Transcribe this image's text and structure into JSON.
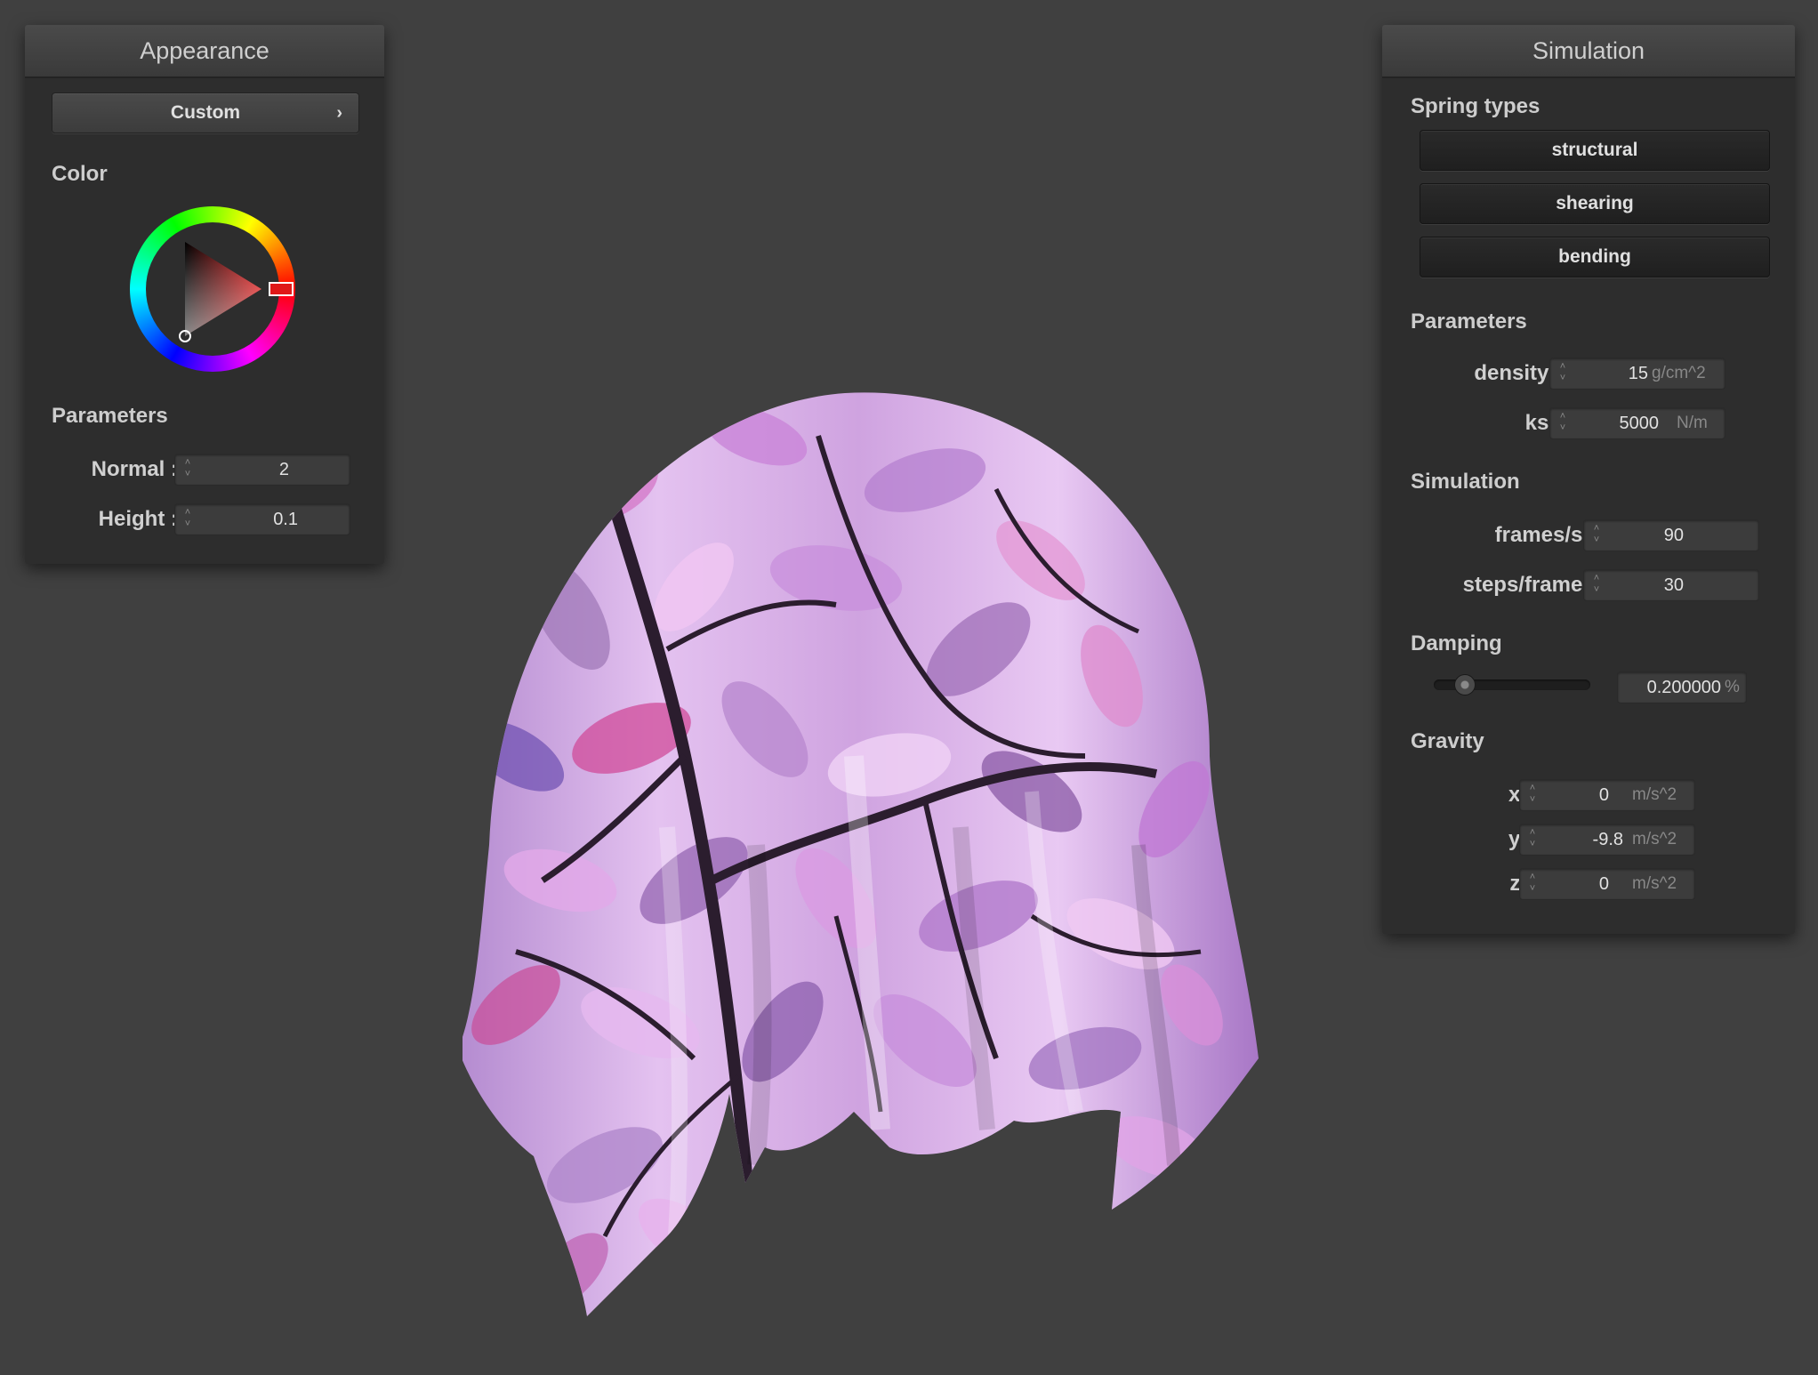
{
  "appearance": {
    "title": "Appearance",
    "preset_label": "Custom",
    "color_label": "Color",
    "color_value": "#e01818",
    "parameters_label": "Parameters",
    "normal_label": "Normal :",
    "normal_value": "2",
    "height_label": "Height :",
    "height_value": "0.1"
  },
  "simulation": {
    "title": "Simulation",
    "spring_types_label": "Spring types",
    "spring_buttons": [
      "structural",
      "shearing",
      "bending"
    ],
    "parameters_label": "Parameters",
    "density_label": "density :",
    "density_value": "15",
    "density_unit": "g/cm^2",
    "ks_label": "ks :",
    "ks_value": "5000",
    "ks_unit": "N/m",
    "simulation_label": "Simulation",
    "fps_label": "frames/s :",
    "fps_value": "90",
    "steps_label": "steps/frame :",
    "steps_value": "30",
    "damping_label": "Damping",
    "damping_value": "0.200000",
    "damping_unit": "%",
    "damping_fraction": 0.2,
    "gravity_label": "Gravity",
    "gx_label": "x :",
    "gx_value": "0",
    "gy_label": "y :",
    "gy_value": "-9.8",
    "gz_label": "z :",
    "gz_value": "0",
    "gravity_unit": "m/s^2"
  },
  "viewport": {
    "background_color": "#404040",
    "cloth_colors": [
      "#c79ad8",
      "#e6b8ee",
      "#8a5aa6",
      "#f3d6f7",
      "#d04b9a",
      "#2b1d2e"
    ]
  }
}
